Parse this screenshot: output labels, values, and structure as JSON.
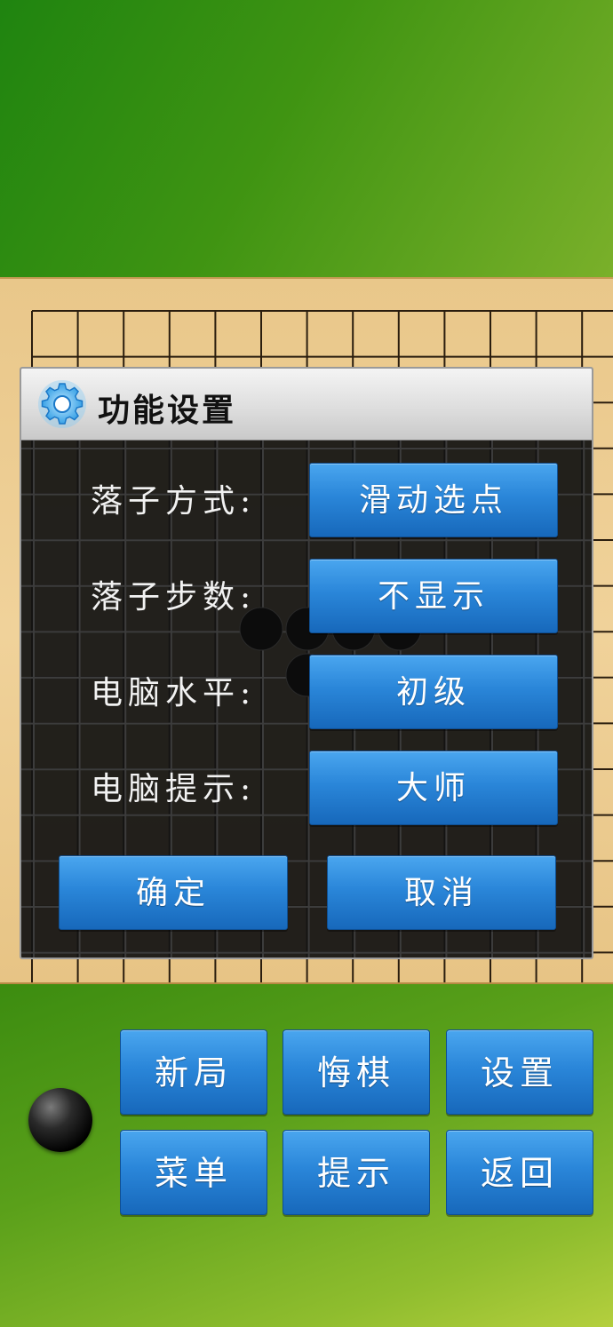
{
  "dialog": {
    "title": "功能设置",
    "icon": "gear-icon",
    "options": [
      {
        "label": "落子方式:",
        "value": "滑动选点"
      },
      {
        "label": "落子步数:",
        "value": "不显示"
      },
      {
        "label": "电脑水平:",
        "value": "初级"
      },
      {
        "label": "电脑提示:",
        "value": "大师"
      }
    ],
    "confirm_label": "确定",
    "cancel_label": "取消"
  },
  "menu": {
    "new_game": "新局",
    "undo": "悔棋",
    "settings": "设置",
    "menu": "菜单",
    "hint": "提示",
    "back": "返回"
  },
  "current_player": "black",
  "colors": {
    "board": "#f0d29a",
    "button_blue": "#2a86d9",
    "background_green": "#4a9a14"
  }
}
